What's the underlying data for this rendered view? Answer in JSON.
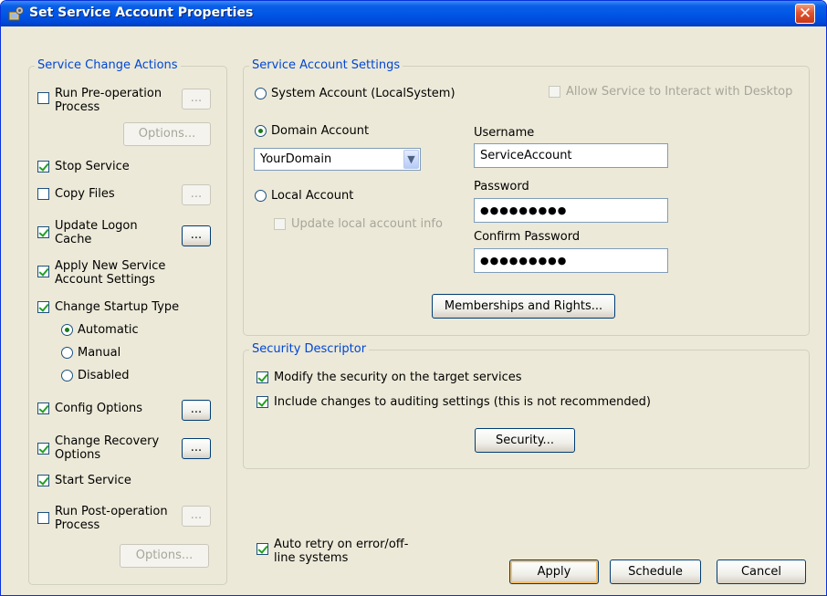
{
  "window": {
    "title": "Set Service Account Properties",
    "close_glyph": "✕"
  },
  "icons": {
    "app": "service-settings-icon",
    "close": "close-icon",
    "dropdown": "chevron-down-icon"
  },
  "colors": {
    "group_header": "#0046d5",
    "titlebar": "#0055e5",
    "close": "#e2532d",
    "check": "#21a121"
  },
  "service_change_actions": {
    "title": "Service Change Actions",
    "run_pre": {
      "label": "Run Pre-operation Process",
      "checked": false,
      "browse": "...",
      "options": "Options..."
    },
    "stop_service": {
      "label": "Stop Service",
      "checked": true
    },
    "copy_files": {
      "label": "Copy Files",
      "checked": false,
      "browse": "..."
    },
    "update_logon_cache": {
      "label": "Update Logon Cache",
      "checked": true,
      "browse": "..."
    },
    "apply_new_settings": {
      "label": "Apply New Service Account Settings",
      "checked": true
    },
    "change_startup_type": {
      "label": "Change Startup Type",
      "checked": true
    },
    "startup": {
      "automatic": "Automatic",
      "manual": "Manual",
      "disabled": "Disabled",
      "selected": "Automatic"
    },
    "config_options": {
      "label": "Config Options",
      "checked": true,
      "browse": "..."
    },
    "change_recovery": {
      "label": "Change Recovery Options",
      "checked": true,
      "browse": "..."
    },
    "start_service": {
      "label": "Start Service",
      "checked": true
    },
    "run_post": {
      "label": "Run Post-operation Process",
      "checked": false,
      "browse": "...",
      "options": "Options..."
    }
  },
  "account_settings": {
    "title": "Service Account Settings",
    "system_account": "System Account (LocalSystem)",
    "allow_desktop": "Allow Service to Interact with Desktop",
    "domain_account": "Domain Account",
    "domain_value": "YourDomain",
    "local_account": "Local Account",
    "update_local_info": "Update local account info",
    "selected": "Domain Account",
    "username_label": "Username",
    "username_value": "ServiceAccount",
    "password_label": "Password",
    "password_value": "●●●●●●●●●",
    "confirm_label": "Confirm Password",
    "confirm_value": "●●●●●●●●●",
    "memberships_button": "Memberships and Rights..."
  },
  "security_descriptor": {
    "title": "Security Descriptor",
    "modify": {
      "label": "Modify the security on the target services",
      "checked": true
    },
    "auditing": {
      "label": "Include changes to auditing settings (this is not recommended)",
      "checked": true
    },
    "security_button": "Security..."
  },
  "auto_retry": {
    "label": "Auto retry on error/off-line systems",
    "checked": true
  },
  "buttons": {
    "apply": "Apply",
    "schedule": "Schedule",
    "cancel": "Cancel"
  }
}
